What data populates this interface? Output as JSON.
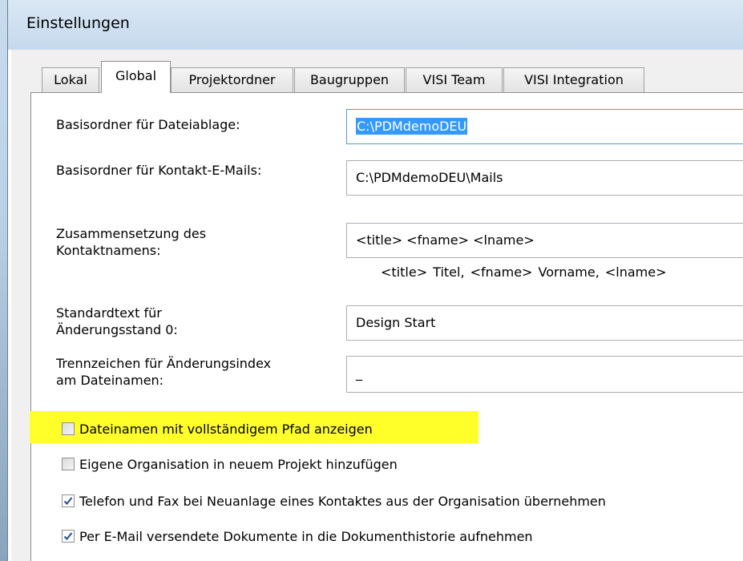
{
  "window": {
    "title": "Einstellungen"
  },
  "tabs": [
    {
      "label": "Lokal",
      "active": false
    },
    {
      "label": "Global",
      "active": true
    },
    {
      "label": "Projektordner",
      "active": false
    },
    {
      "label": "Baugruppen",
      "active": false
    },
    {
      "label": "VISI Team",
      "active": false
    },
    {
      "label": "VISI Integration",
      "active": false
    }
  ],
  "form": {
    "basisordner_label": "Basisordner für Dateiablage:",
    "basisordner_value": "C:\\PDMdemoDEU",
    "kontakt_mails_label": "Basisordner für Kontakt-E-Mails:",
    "kontakt_mails_value": "C:\\PDMdemoDEU\\Mails",
    "kontaktname_label_1": "Zusammensetzung des",
    "kontaktname_label_2": "Kontaktnamens:",
    "kontaktname_value": "<title> <fname> <lname>",
    "kontaktname_hint": "<title> Titel,   <fname> Vorname,   <lname>",
    "standardtext_label_1": "Standardtext für",
    "standardtext_label_2": "Änderungsstand 0:",
    "standardtext_value": "Design Start",
    "trennzeichen_label_1": "Trennzeichen für Änderungsindex",
    "trennzeichen_label_2": "am Dateinamen:",
    "trennzeichen_value": "_"
  },
  "checkboxes": [
    {
      "label": "Dateinamen mit vollständigem Pfad anzeigen",
      "checked": false,
      "highlighted": true
    },
    {
      "label": "Eigene Organisation in neuem Projekt hinzufügen",
      "checked": false
    },
    {
      "label": "Telefon und Fax bei Neuanlage eines Kontaktes aus der Organisation übernehmen",
      "checked": true
    },
    {
      "label": "Per E-Mail versendete Dokumente in die Dokumenthistorie aufnehmen",
      "checked": true
    }
  ],
  "colors": {
    "highlight": "#ffff2a",
    "selection": "#3399ff",
    "checkmark": "#1f4e9c"
  }
}
